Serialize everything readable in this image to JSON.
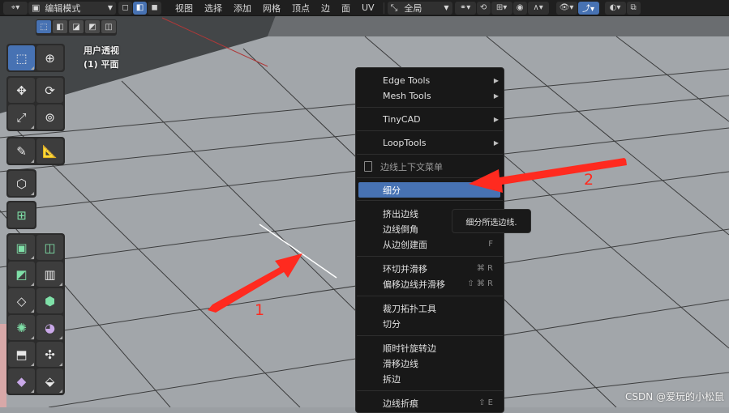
{
  "header": {
    "mode_label": "编辑模式",
    "menus": [
      "视图",
      "选择",
      "添加",
      "网格",
      "顶点",
      "边",
      "面",
      "UV"
    ],
    "orientation_label": "全局"
  },
  "viewport": {
    "view_name": "用户透视",
    "object_name": "(1) 平面"
  },
  "context_menu": {
    "groups": [
      [
        {
          "label": "Edge Tools",
          "submenu": true
        },
        {
          "label": "Mesh Tools",
          "submenu": true
        }
      ],
      [
        {
          "label": "TinyCAD",
          "submenu": true
        }
      ],
      [
        {
          "label": "LoopTools",
          "submenu": true
        }
      ],
      [
        {
          "label": "边线上下文菜单",
          "title": true
        }
      ],
      [
        {
          "label": "细分",
          "highlighted": true
        }
      ],
      [
        {
          "label": "挤出边线"
        },
        {
          "label": "边线倒角"
        },
        {
          "label": "从边创建面",
          "shortcut": "F"
        }
      ],
      [
        {
          "label": "环切并滑移",
          "shortcut": "⌘ R"
        },
        {
          "label": "偏移边线并滑移",
          "shortcut": "⇧ ⌘ R"
        }
      ],
      [
        {
          "label": "裁刀拓扑工具"
        },
        {
          "label": "切分"
        }
      ],
      [
        {
          "label": "顺时针旋转边"
        },
        {
          "label": "滑移边线"
        },
        {
          "label": "拆边"
        }
      ],
      [
        {
          "label": "边线折痕",
          "shortcut": "⇧ E"
        }
      ]
    ]
  },
  "tooltip": {
    "text": "细分所选边线."
  },
  "annotations": {
    "arrow1_label": "1",
    "arrow2_label": "2",
    "color": "#ff2a1f"
  },
  "watermark": "CSDN @爱玩的小松鼠",
  "toolbar_icons": [
    "select-box",
    "cursor",
    "move",
    "rotate",
    "scale",
    "transform",
    "annotate",
    "measure",
    "add-cube",
    "extrude-region",
    "inset-faces",
    "bevel",
    "loop-cut",
    "knife",
    "poly-build",
    "spin",
    "smooth",
    "shrink-fatten",
    "shear",
    "rip-region"
  ]
}
